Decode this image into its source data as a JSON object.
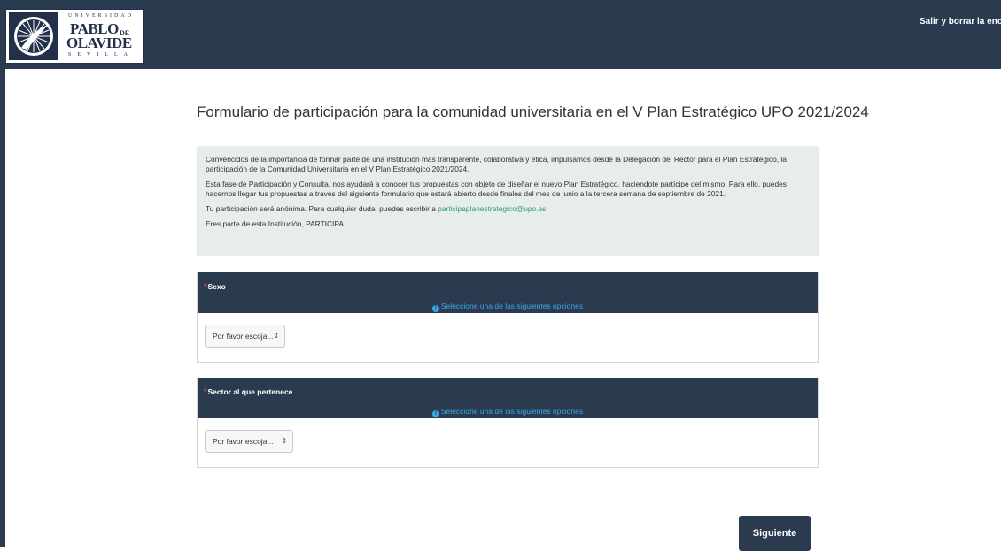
{
  "header": {
    "logo": {
      "universidad": "UNIVERSIDAD",
      "name_line1": "PABLO",
      "de": "DE",
      "name_line2": "OLAVIDE",
      "city": "SEVILLA"
    },
    "exit_link": "Salir y borrar la encuesta"
  },
  "survey": {
    "title": "Formulario de participación para la comunidad universitaria en el V Plan Estratégico UPO 2021/2024",
    "intro": {
      "p1": "Convencidos de la importancia de formar parte de una institución más transparente, colaborativa y ética, impulsamos desde la Delegación del Rector para el Plan Estratégico, la participación de la Comunidad Universitaria en el V Plan Estratégico 2021/2024.",
      "p2": "Esta fase de Participación y Consulta, nos ayudará a conocer tus propuestas con objeto de diseñar el nuevo Plan Estratégico, haciendote partícipe del mismo. Para ello, puedes hacernos llegar tus propuestas a través del siguiente formulario que estará abierto desde finales del mes de junio a la tercera semana de septiembre de 2021.",
      "p3_prefix": "Tu participación será anónima. Para cualquier duda, puedes escribir a ",
      "email": "participaplanestrategico@upo.es",
      "p4": "Eres parte de esta Institución, PARTICIPA."
    }
  },
  "questions": [
    {
      "required_mark": "*",
      "title": "Sexo",
      "help": "Seleccione una de las siguientes opciones",
      "select_value": "Por favor escoja...",
      "arrows": "⇕"
    },
    {
      "required_mark": "*",
      "title": "Sector al que pertenece",
      "help": "Seleccione una de las siguientes opciones",
      "select_value": "Por favor escoja...",
      "arrows": "⇕"
    }
  ],
  "footer": {
    "next_label": "Siguiente"
  },
  "colors": {
    "header_bg": "#2a3a4f",
    "help_text": "#3aa9e8",
    "required": "#e0403a",
    "link": "#2aa06e",
    "intro_bg": "#e7ecec"
  }
}
